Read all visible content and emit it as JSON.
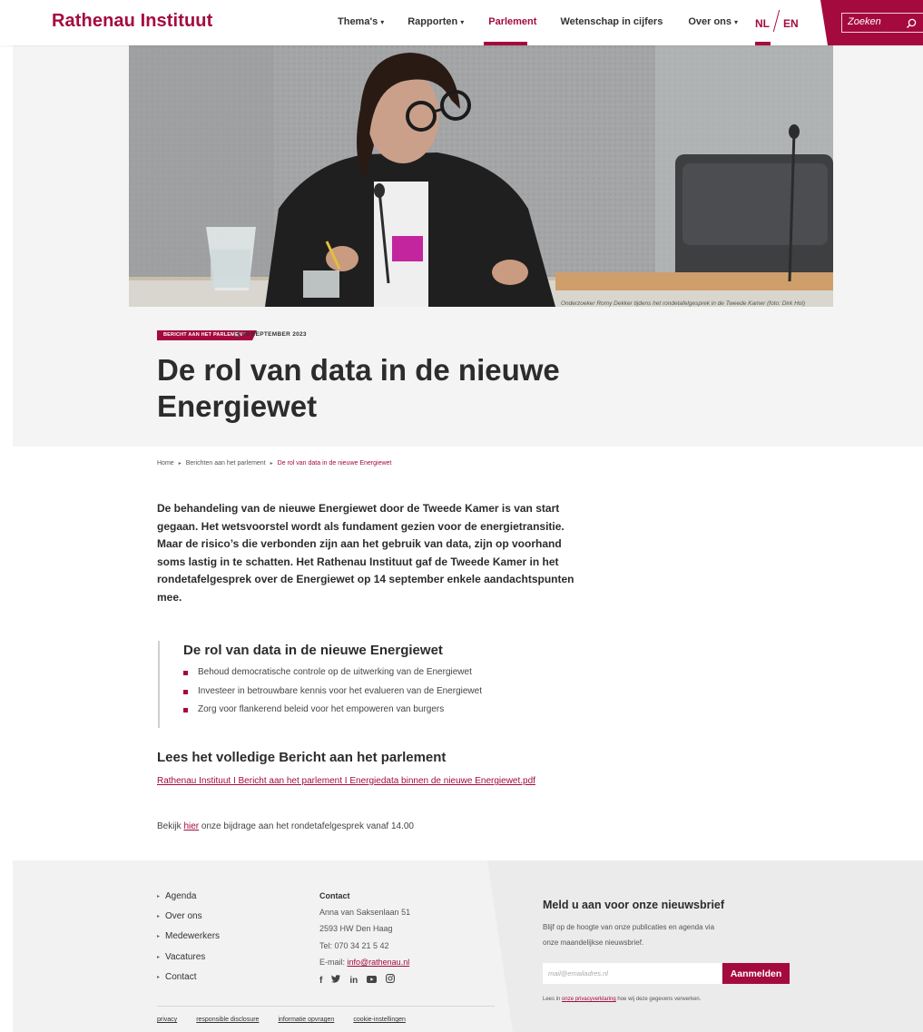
{
  "site": {
    "logo": "Rathenau Instituut",
    "accent_color": "#a50a3f"
  },
  "nav": {
    "items": [
      {
        "label": "Thema's",
        "dropdown": true
      },
      {
        "label": "Rapporten",
        "dropdown": true
      },
      {
        "label": "Parlement",
        "dropdown": false,
        "active": true
      },
      {
        "label": "Wetenschap in cijfers",
        "dropdown": false
      },
      {
        "label": "Over ons",
        "dropdown": true
      }
    ],
    "lang": {
      "nl": "NL",
      "en": "EN",
      "active": "NL"
    },
    "search": {
      "placeholder": "Zoeken",
      "icon": "search-icon"
    }
  },
  "hero": {
    "caption": "Onderzoeker Romy Dekker tijdens het rondetafelgesprek in de Tweede Kamer (foto: Dirk Hol)",
    "label": "BERICHT AAN HET PARLEMENT",
    "date": "15 SEPTEMBER 2023",
    "title": "De rol van data in de nieuwe Energiewet"
  },
  "breadcrumb": [
    "Home",
    "Berichten aan het parlement",
    "De rol van data in de nieuwe Energiewet"
  ],
  "intro": "De behandeling van de nieuwe Energiewet door de Tweede Kamer is van start gegaan. Het wetsvoorstel wordt als fundament gezien voor de energietransitie. Maar de risico’s die verbonden zijn aan het gebruik van data, zijn op voorhand soms lastig in te schatten. Het Rathenau Instituut gaf de Tweede Kamer in het rondetafelgesprek over de Energiewet op 14 september enkele aandachtspunten mee.",
  "key_points": {
    "title": "De rol van data in de nieuwe Energiewet",
    "items": [
      "Behoud democratische controle op de uitwerking van de Energiewet",
      "Investeer in betrouwbare kennis voor het evalueren van de Energiewet",
      "Zorg voor flankerend beleid voor het empoweren van burgers"
    ]
  },
  "read_more": {
    "title": "Lees het volledige Bericht aan het parlement",
    "link": "Rathenau Instituut I Bericht aan het parlement I Energiedata binnen de nieuwe Energiewet.pdf",
    "watch_before": "Bekijk ",
    "watch_link": "hier",
    "watch_after": " onze bijdrage aan het rondetafelgesprek vanaf 14.00"
  },
  "footer": {
    "links": [
      "Agenda",
      "Over ons",
      "Medewerkers",
      "Vacatures",
      "Contact"
    ],
    "contact": {
      "title": "Contact",
      "address1": "Anna van Saksenlaan 51",
      "address2": "2593 HW Den Haag",
      "phone": "Tel: 070 34 21 5 42",
      "email_label": "E-mail: ",
      "email": "info@rathenau.nl"
    },
    "social": [
      "facebook-icon",
      "twitter-icon",
      "linkedin-icon",
      "youtube-icon",
      "instagram-icon"
    ],
    "bottom_links": [
      "privacy",
      "responsible disclosure",
      "informatie opvragen",
      "cookie-instellingen"
    ],
    "newsletter": {
      "title": "Meld u aan voor onze nieuwsbrief",
      "text": "Blijf op de hoogte van onze publicaties en agenda via onze maandelijkse nieuwsbrief.",
      "placeholder": "mail@emailadres.nl",
      "button": "Aanmelden",
      "note_before": "Lees in ",
      "note_link": "onze privacyverklaring",
      "note_after": " hoe wij deze gegevens verwerken."
    }
  }
}
